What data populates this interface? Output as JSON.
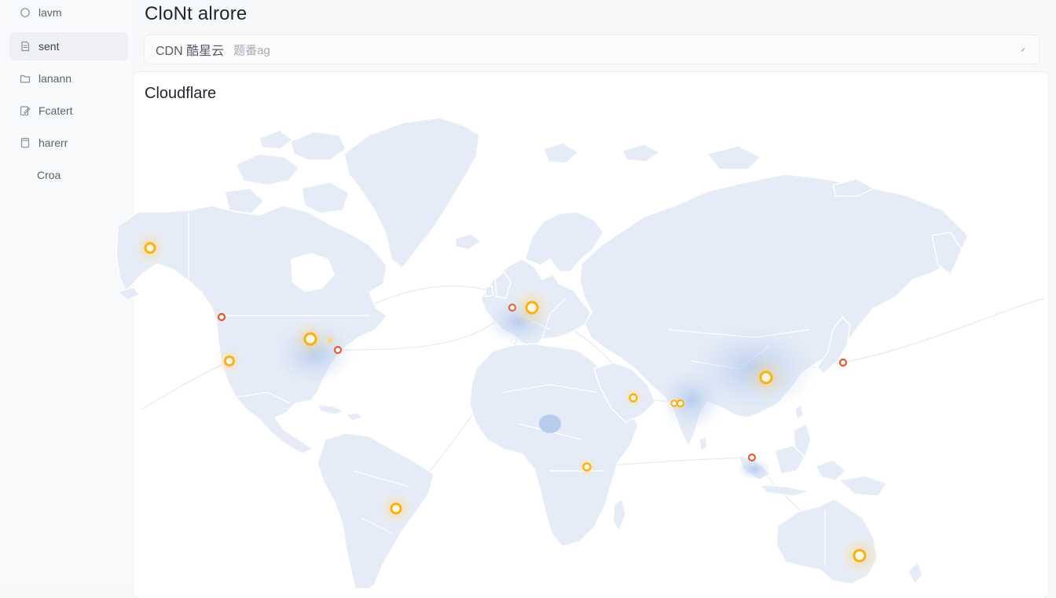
{
  "sidebar": {
    "items": [
      {
        "label": "lavm",
        "icon": "circle-icon"
      },
      {
        "label": "sent",
        "icon": "document-icon",
        "active": true
      },
      {
        "label": "lanann",
        "icon": "folder-icon"
      },
      {
        "label": "Fcatert",
        "icon": "edit-icon"
      },
      {
        "label": "harerr",
        "icon": "file-icon"
      },
      {
        "label": "Croa",
        "icon": ""
      }
    ]
  },
  "header": {
    "title": "CloNt alrore",
    "select_value": "CDN 酷星云",
    "select_hint": "题番ag"
  },
  "map": {
    "title": "Cloudflare",
    "colors": {
      "land": "#e6ecf7",
      "highlight": "#cfddf3",
      "pop_primary": "#f5b21e",
      "pop_secondary": "#e2613b"
    },
    "nodes": [
      {
        "region": "Alaska",
        "color": "primary"
      },
      {
        "region": "Seattle",
        "color": "secondary"
      },
      {
        "region": "Los Angeles",
        "color": "primary"
      },
      {
        "region": "Chicago",
        "color": "primary"
      },
      {
        "region": "New York",
        "color": "secondary"
      },
      {
        "region": "Sao Paulo",
        "color": "primary"
      },
      {
        "region": "London",
        "color": "secondary"
      },
      {
        "region": "Frankfurt",
        "color": "primary"
      },
      {
        "region": "Dubai",
        "color": "primary"
      },
      {
        "region": "Mumbai",
        "color": "primary"
      },
      {
        "region": "Nairobi",
        "color": "primary"
      },
      {
        "region": "China",
        "color": "primary"
      },
      {
        "region": "Tokyo",
        "color": "secondary"
      },
      {
        "region": "Singapore",
        "color": "secondary"
      },
      {
        "region": "Sydney",
        "color": "primary"
      }
    ]
  }
}
